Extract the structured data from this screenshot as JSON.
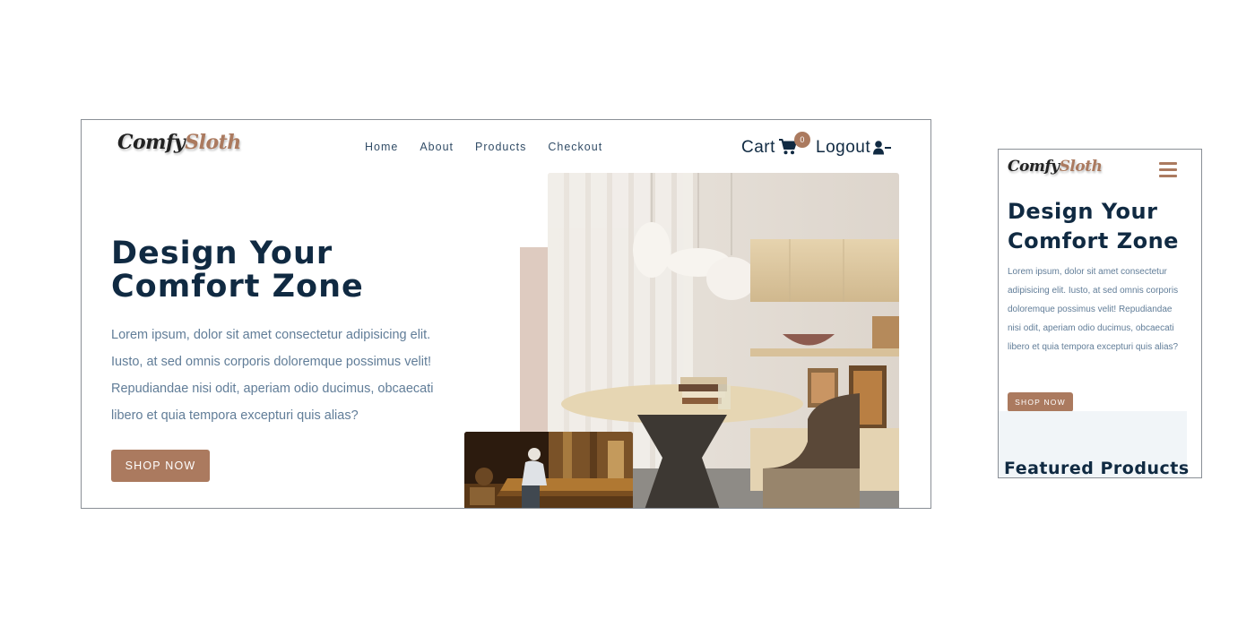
{
  "desktop": {
    "logo": {
      "part1": "Comfy",
      "part2": "Sloth"
    },
    "nav": {
      "links": [
        "Home",
        "About",
        "Products",
        "Checkout"
      ]
    },
    "cart": {
      "label": "Cart",
      "count": "0"
    },
    "logout": {
      "label": "Logout"
    },
    "hero": {
      "title_line1": "Design Your",
      "title_line2": "Comfort Zone",
      "text": "Lorem ipsum, dolor sit amet consectetur adipisicing elit. Iusto, at sed omnis corporis doloremque possimus velit! Repudiandae nisi odit, aperiam odio ducimus, obcaecati libero et quia tempora excepturi quis alias?",
      "button": "SHOP NOW"
    }
  },
  "mobile": {
    "logo": {
      "part1": "Comfy",
      "part2": "Sloth"
    },
    "hero": {
      "title_line1": "Design Your",
      "title_line2": "Comfort Zone",
      "text": "Lorem ipsum, dolor sit amet consectetur adipisicing elit. Iusto, at sed omnis corporis doloremque possimus velit! Repudiandae nisi odit, aperiam odio ducimus, obcaecati libero et quia tempora excepturi quis alias?",
      "button": "SHOP NOW"
    },
    "featured": {
      "title": "Featured Products"
    }
  },
  "colors": {
    "brand": "#ab7a5f",
    "heading": "#102a42",
    "body_text": "#617d98",
    "accent_block": "#decbc0",
    "section_bg": "#f1f5f8"
  },
  "icons": {
    "cart": "shopping-cart-icon",
    "logout": "user-minus-icon",
    "menu": "hamburger-menu-icon"
  }
}
